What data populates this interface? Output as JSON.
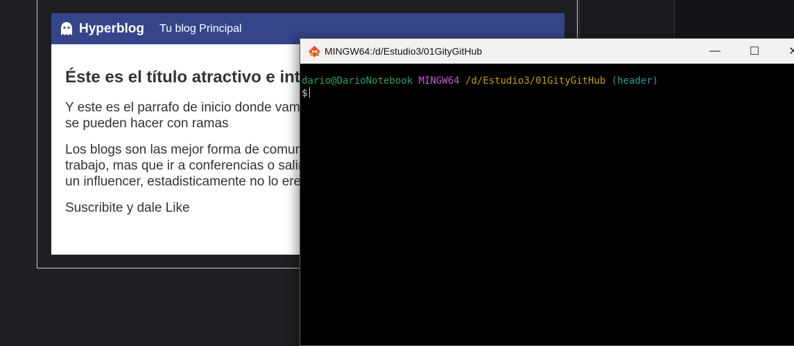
{
  "blog": {
    "brand": "Hyperblog",
    "nav_link": "Tu blog Principal",
    "post_title": "Éste es el título atractivo e interesante",
    "paragraphs": [
      "Y este es el parrafo de inicio donde vamos a ver todas las cosas que se pueden hacer con ramas",
      "Los blogs son las mejor forma de comunicar tus ideas y mostrar tu trabajo, mas que ir a conferencias o salir en YouTube porque no eres un influencer, estadisticamente no lo eres ... por ahora",
      "Suscribite y dale Like"
    ]
  },
  "terminal": {
    "title": "MINGW64:/d/Estudio3/01GityGitHub",
    "prompt": {
      "user_host": "dario@DarioNotebook",
      "system": "MINGW64",
      "path": "/d/Estudio3/01GityGitHub",
      "branch": "(header)",
      "symbol": "$"
    },
    "buttons": {
      "minimize": "—",
      "maximize": "☐",
      "close": "✕"
    }
  },
  "colors": {
    "blog_header": "#34458a",
    "terminal_user": "#26a269",
    "terminal_system": "#c061cb",
    "terminal_path": "#c4a000",
    "terminal_branch": "#2aa198"
  }
}
